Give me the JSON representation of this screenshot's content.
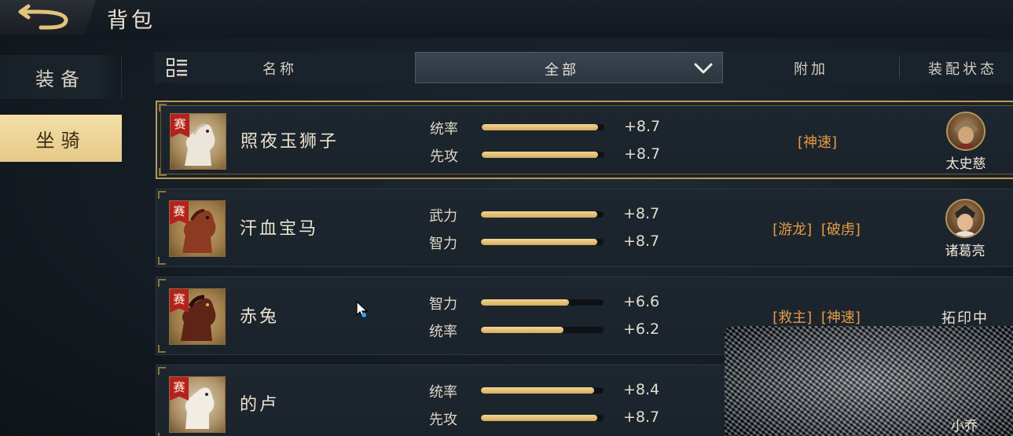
{
  "topbar": {
    "title": "背包",
    "back_icon": "back-arrow-icon"
  },
  "sidebar": {
    "tabs": [
      {
        "label": "装备",
        "active": false
      },
      {
        "label": "坐骑",
        "active": true
      }
    ]
  },
  "header": {
    "name_label": "名称",
    "filter": {
      "selected": "全部"
    },
    "extra_label": "附加",
    "equip_label": "装配状态"
  },
  "rows": [
    {
      "badge": "赛",
      "name": "照夜玉狮子",
      "stats": [
        {
          "label": "统率",
          "value": "+8.7",
          "fill": 0.95
        },
        {
          "label": "先攻",
          "value": "+8.7",
          "fill": 0.95
        }
      ],
      "skills": [
        "[神速]"
      ],
      "equipped_by": "太史慈",
      "selected": true
    },
    {
      "badge": "赛",
      "name": "汗血宝马",
      "stats": [
        {
          "label": "武力",
          "value": "+8.7",
          "fill": 0.95
        },
        {
          "label": "智力",
          "value": "+8.7",
          "fill": 0.95
        }
      ],
      "skills": [
        "[游龙]",
        "[破虏]"
      ],
      "equipped_by": "诸葛亮",
      "selected": false
    },
    {
      "badge": "赛",
      "name": "赤兔",
      "stats": [
        {
          "label": "智力",
          "value": "+6.6",
          "fill": 0.72
        },
        {
          "label": "统率",
          "value": "+6.2",
          "fill": 0.67
        }
      ],
      "skills": [
        "[救主]",
        "[神速]"
      ],
      "status": "拓印中",
      "selected": false
    },
    {
      "badge": "赛",
      "name": "的卢",
      "stats": [
        {
          "label": "统率",
          "value": "+8.4",
          "fill": 0.92
        },
        {
          "label": "先攻",
          "value": "+8.7",
          "fill": 0.95
        }
      ],
      "skills": [],
      "equipped_by": "小乔",
      "selected": false
    }
  ],
  "colors": {
    "accent_gold": "#e6c987",
    "skill_orange": "#e49b45",
    "badge_red": "#b3221f"
  }
}
